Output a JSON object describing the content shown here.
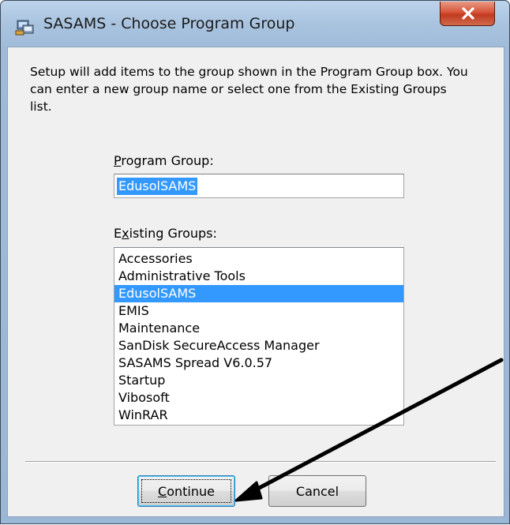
{
  "window": {
    "title": "SASAMS - Choose Program Group",
    "close_glyph": "x"
  },
  "description": "Setup will add items to the group shown in the Program Group box. You can enter a new group name or select one from the Existing Groups list.",
  "program_group": {
    "label_before": "",
    "label_accel": "P",
    "label_after": "rogram Group:",
    "value": "EdusolSAMS"
  },
  "existing_groups": {
    "label_before": "E",
    "label_accel": "x",
    "label_after": "isting Groups:",
    "items": [
      "Accessories",
      "Administrative Tools",
      "EdusolSAMS",
      "EMIS",
      "Maintenance",
      "SanDisk SecureAccess Manager",
      "SASAMS Spread V6.0.57",
      "Startup",
      "Vibosoft",
      "WinRAR"
    ],
    "selected_index": 2
  },
  "buttons": {
    "continue_before": "",
    "continue_accel": "C",
    "continue_after": "ontinue",
    "cancel": "Cancel"
  },
  "colors": {
    "selection": "#3399ff",
    "annotation_arrow": "#000000"
  }
}
